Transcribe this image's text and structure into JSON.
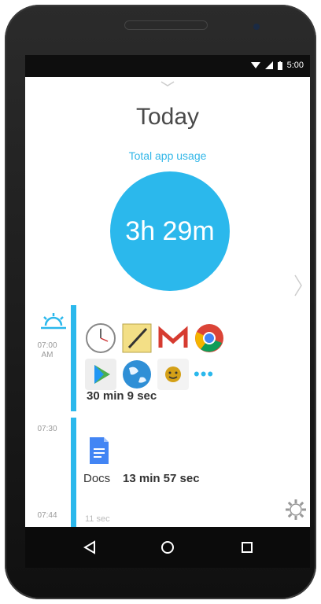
{
  "status": {
    "time": "5:00"
  },
  "header": {
    "title": "Today",
    "subtitle": "Total app usage"
  },
  "summary": {
    "total": "3h 29m"
  },
  "timeline": {
    "entries": [
      {
        "time": "07:00\nAM",
        "duration": "30 min 9 sec",
        "apps": [
          "clock-icon",
          "notes-icon",
          "gmail-icon",
          "chrome-icon",
          "play-store-icon",
          "earth-icon",
          "smile-app-icon"
        ],
        "more": "•••"
      },
      {
        "time": "07:30",
        "app_label": "Docs",
        "duration": "13 min 57 sec"
      },
      {
        "time": "07:44",
        "duration": "11 sec"
      }
    ]
  },
  "colors": {
    "accent": "#2bb8ec",
    "text": "#333333"
  }
}
